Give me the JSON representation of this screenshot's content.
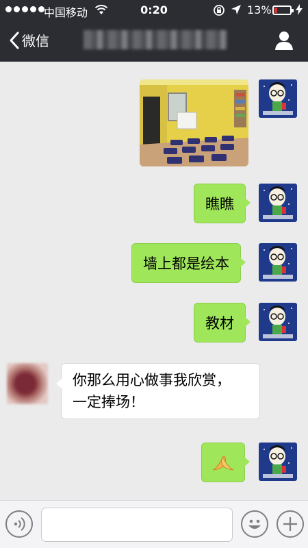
{
  "status_bar": {
    "carrier": "中国移动",
    "time": "0:20",
    "battery_percent": "13%",
    "battery_color": "#e0312d"
  },
  "nav": {
    "back_label": "微信",
    "title_obscured": true,
    "back_icon": "chevron-left-icon",
    "profile_icon": "person-icon"
  },
  "messages": [
    {
      "sender": "me",
      "type": "image",
      "description_icon": "classroom-photo"
    },
    {
      "sender": "me",
      "type": "text",
      "text": "瞧瞧"
    },
    {
      "sender": "me",
      "type": "text",
      "text": "墙上都是绘本"
    },
    {
      "sender": "me",
      "type": "text",
      "text": "教材"
    },
    {
      "sender": "other",
      "type": "text",
      "lines": [
        "你那么用心做事我欣赏，",
        "一定捧场！"
      ]
    },
    {
      "sender": "me",
      "type": "emoji",
      "emoji": "🙏"
    }
  ],
  "input_bar": {
    "voice_icon": "voice-icon",
    "emoji_icon": "smiley-icon",
    "add_icon": "plus-icon",
    "placeholder": ""
  },
  "colors": {
    "header_bg": "#2b2d33",
    "chat_bg": "#ebebeb",
    "my_bubble": "#9fe65a",
    "other_bubble": "#ffffff"
  }
}
